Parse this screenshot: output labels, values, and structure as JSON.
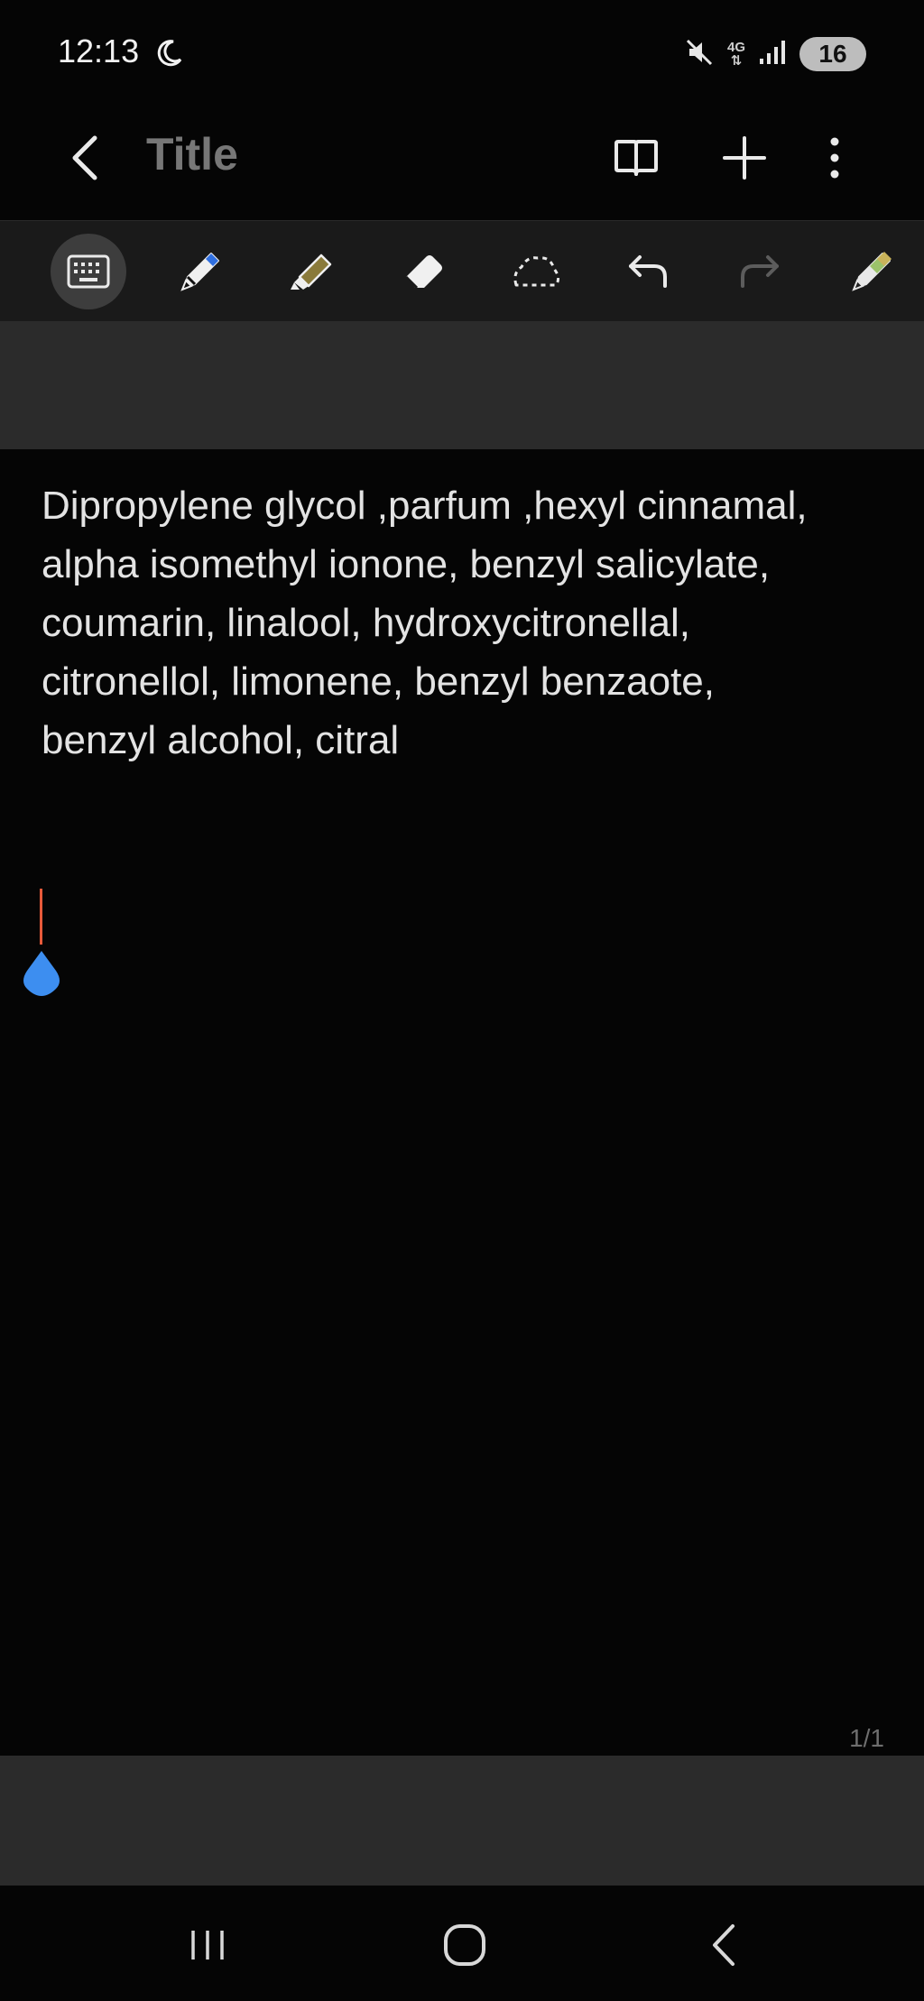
{
  "status_bar": {
    "time": "12:13",
    "network_label": "4G",
    "battery": "16",
    "icons": [
      "moon-icon",
      "mute-icon",
      "network-4g-icon",
      "signal-icon",
      "battery-icon"
    ]
  },
  "app_bar": {
    "title": "Title",
    "icons": [
      "back-icon",
      "book-view-icon",
      "plus-icon",
      "more-vertical-icon"
    ]
  },
  "toolbar": {
    "tools": [
      "keyboard-icon",
      "pen-icon",
      "highlighter-icon",
      "eraser-icon",
      "lasso-select-icon",
      "undo-icon",
      "redo-icon",
      "pen-settings-icon"
    ],
    "active_tool": "keyboard-icon"
  },
  "note": {
    "lines": [
      "Dipropylene glycol ,parfum ,hexyl cinnamal,",
      "alpha isomethyl ionone, benzyl salicylate,",
      "coumarin, linalool, hydroxycitronellal,",
      "citronellol, limonene, benzyl benzaote,",
      "benzyl alcohol, citral"
    ],
    "page_indicator": "1/1"
  },
  "nav_bar": {
    "icons": [
      "recent-apps-icon",
      "home-icon",
      "nav-back-icon"
    ]
  },
  "colors": {
    "background": "#050505",
    "toolbar": "#1a1a1a",
    "band": "#2b2b2b",
    "cursor": "#e85a3a",
    "handle": "#3d8ef0"
  }
}
